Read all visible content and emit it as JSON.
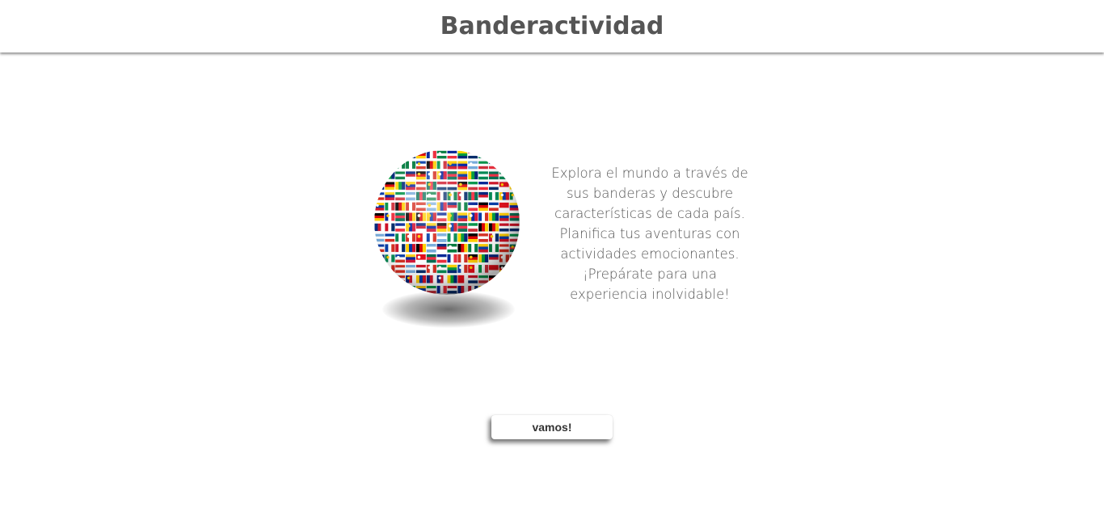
{
  "header": {
    "title": "Banderactividad"
  },
  "hero": {
    "image": "flag-globe",
    "description": "Explora el mundo a través de sus banderas y descubre características de cada país. Planifica tus aventuras con actividades emocionantes. ¡Prepárate para una experiencia inolvidable!"
  },
  "cta": {
    "label": "vamos!"
  },
  "colors": {
    "title": "#555555",
    "text": "#555555",
    "background": "#ffffff"
  }
}
